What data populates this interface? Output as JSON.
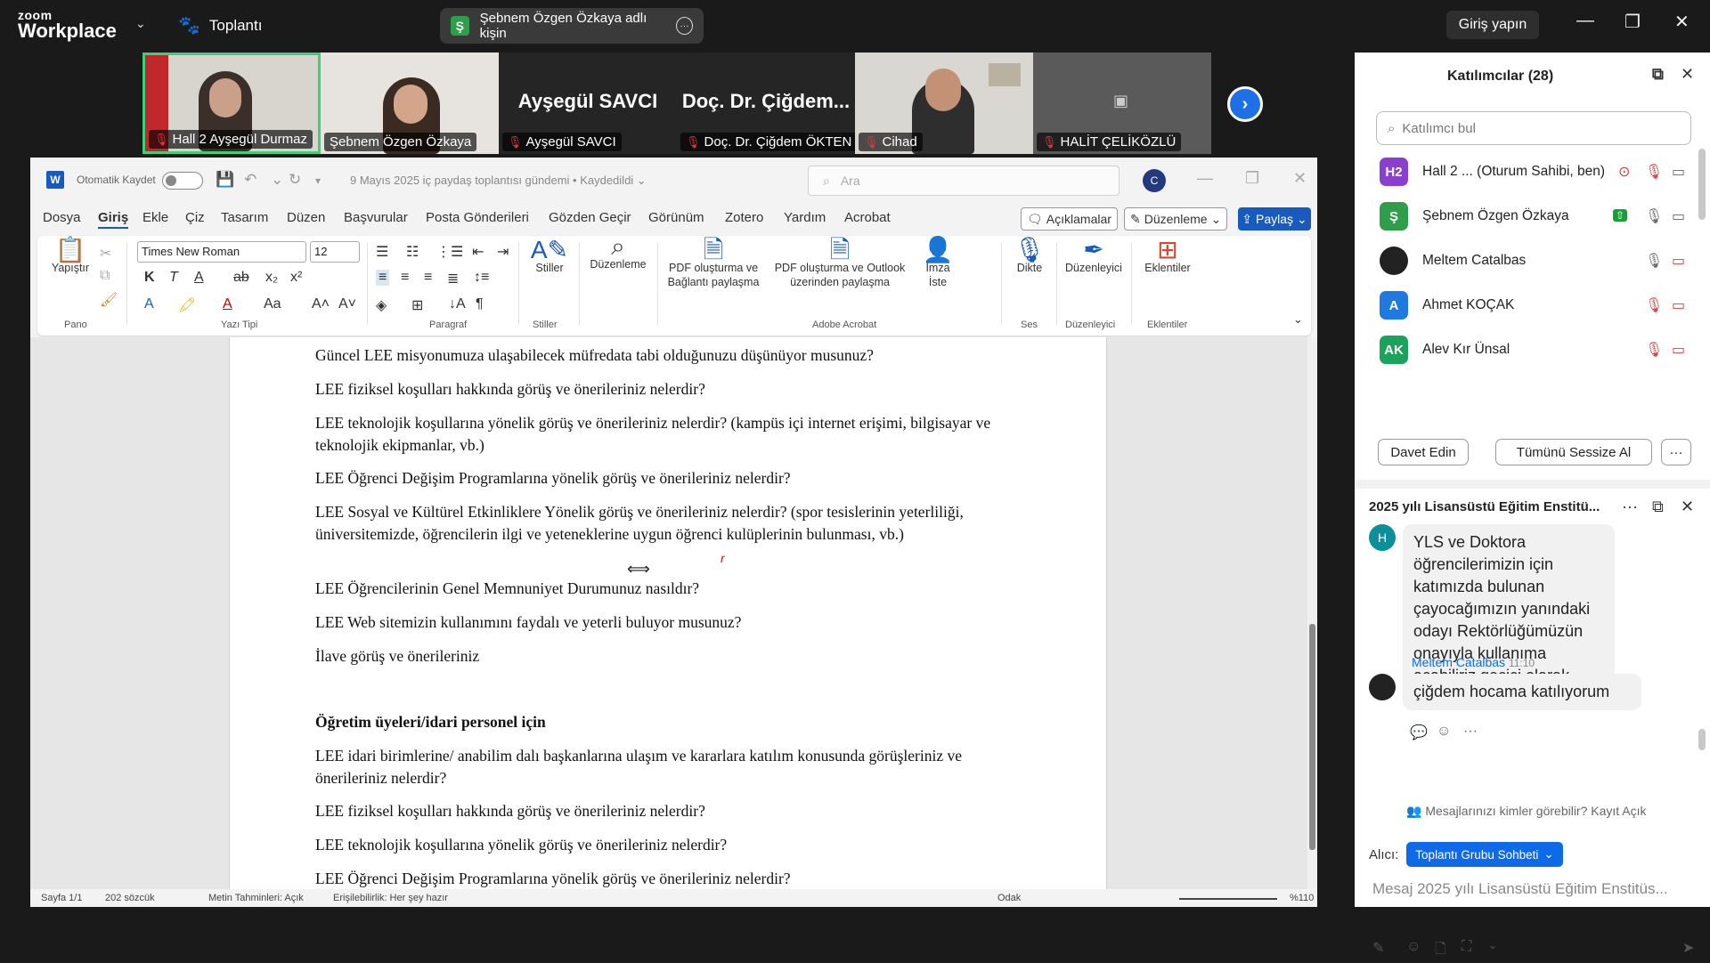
{
  "zoom": {
    "logo_line1": "zoom",
    "logo_line2": "Workplace",
    "meeting_label": "Toplantı",
    "active_speaker": "Şebnem Özgen Özkaya adlı kişin",
    "active_speaker_badge": "Ş",
    "signin": "Giriş yapın"
  },
  "tiles": [
    {
      "name": "Hall 2 Ayşegül Durmaz",
      "video": true,
      "active": true
    },
    {
      "name": "Şebnem Özgen Özkaya",
      "video": true,
      "active": false
    },
    {
      "name": "Ayşegül SAVCI",
      "big": "Ayşegül SAVCI",
      "video": false
    },
    {
      "name": "Doç. Dr. Çiğdem ÖKTEN",
      "big": "Doç. Dr. Çiğdem...",
      "video": false
    },
    {
      "name": "Cihad",
      "video": true
    },
    {
      "name": "HALİT ÇELİKÖZLÜ",
      "video": false
    }
  ],
  "word": {
    "autosave": "Otomatik Kaydet",
    "doc_title": "9 Mayıs 2025 iç paydaş toplantısı gündemi • Kaydedildi",
    "search_placeholder": "Ara",
    "user_initial": "C",
    "menu": [
      "Dosya",
      "Giriş",
      "Ekle",
      "Çiz",
      "Tasarım",
      "Düzen",
      "Başvurular",
      "Posta Gönderileri",
      "Gözden Geçir",
      "Görünüm",
      "Zotero",
      "Yardım",
      "Acrobat"
    ],
    "comments_btn": "Açıklamalar",
    "edit_btn": "Düzenleme",
    "share_btn": "Paylaş",
    "ribbon": {
      "paste": "Yapıştır",
      "group_pano": "Pano",
      "font_name": "Times New Roman",
      "font_size": "12",
      "group_font": "Yazı Tipi",
      "group_para": "Paragraf",
      "styles": "Stiller",
      "group_styles": "Stiller",
      "editing": "Düzenleme",
      "pdf_link_1": "PDF oluşturma ve",
      "pdf_link_2": "Bağlantı paylaşma",
      "pdf_outlook_1": "PDF oluşturma ve Outlook",
      "pdf_outlook_2": "üzerinden paylaşma",
      "sign_1": "İmza",
      "sign_2": "İste",
      "group_acrobat": "Adobe Acrobat",
      "dictate": "Dikte",
      "group_voice": "Ses",
      "editor": "Düzenleyici",
      "group_editor": "Düzenleyici",
      "addins": "Eklentiler",
      "group_addins": "Eklentiler"
    },
    "paragraphs": [
      "Güncel LEE misyonumuza ulaşabilecek müfredata tabi olduğunuzu düşünüyor musunuz?",
      "LEE fiziksel koşulları hakkında görüş ve önerileriniz nelerdir?",
      "LEE teknolojik koşullarına yönelik görüş ve önerileriniz nelerdir? (kampüs içi internet erişimi, bilgisayar ve teknolojik ekipmanlar, vb.)",
      "LEE Öğrenci Değişim Programlarına yönelik görüş ve önerileriniz nelerdir?",
      "LEE Sosyal ve Kültürel Etkinliklere Yönelik görüş ve önerileriniz nelerdir? (spor tesislerinin yeterliliği, üniversitemizde, öğrencilerin ilgi ve yeteneklerine uygun öğrenci kulüplerinin bulunması, vb.)",
      "LEE Öğrencilerinin Genel Memnuniyet Durumunuz nasıldır?",
      "LEE Web sitemizin kullanımını faydalı ve yeterli buluyor musunuz?",
      "İlave görüş ve önerileriniz",
      "Öğretim üyeleri/idari personel için",
      "LEE idari birimlerine/ anabilim dalı başkanlarına ulaşım ve kararlara katılım konusunda görüşleriniz ve önerileriniz nelerdir?",
      "LEE fiziksel koşulları hakkında görüş ve önerileriniz nelerdir?",
      "LEE teknolojik koşullarına yönelik görüş ve önerileriniz nelerdir?",
      "LEE Öğrenci Değişim Programlarına yönelik görüş ve önerileriniz nelerdir?"
    ],
    "status": {
      "page": "Sayfa 1/1",
      "words": "202 sözcük",
      "predictions": "Metin Tahminleri: Açık",
      "accessibility": "Erişilebilirlik: Her şey hazır",
      "focus": "Odak",
      "zoom": "%110"
    }
  },
  "participants": {
    "title": "Katılımcılar (28)",
    "search_placeholder": "Katılımcı bul",
    "list": [
      {
        "initials": "H2",
        "name": "Hall 2 ...  (Oturum Sahibi, ben)",
        "color": "#8a3fcf"
      },
      {
        "initials": "Ş",
        "name": "Şebnem Özgen Özkaya",
        "color": "#2e9e4b"
      },
      {
        "initials": "",
        "name": "Meltem Catalbas",
        "color": "#222222"
      },
      {
        "initials": "A",
        "name": "Ahmet KOÇAK",
        "color": "#1f7ae0"
      },
      {
        "initials": "AK",
        "name": "Alev Kır Ünsal",
        "color": "#1aa35a"
      }
    ],
    "invite": "Davet Edin",
    "mute_all": "Tümünü Sessize Al",
    "more": "···"
  },
  "chat": {
    "title": "2025 yılı Lisansüstü Eğitim Enstitü...",
    "msg1_avatar": "H",
    "msg1": "YLS ve Doktora öğrencilerimizin için katımızda bulunan çayocağımızın yanındaki odayı Rektörlüğümüzün onayıyla kullanıma açabiliriz geçici olarak",
    "msg2_sender": "Meltem Catalbas",
    "msg2_time": "11:10",
    "msg2": "çiğdem hocama katılıyorum",
    "visibility": "Mesajlarınızı kimler görebilir? Kayıt Açık",
    "to_label": "Alıcı:",
    "to_value": "Toplantı Grubu Sohbeti",
    "input_placeholder": "Mesaj 2025 yılı Lisansüstü Eğitim Enstitüs..."
  }
}
